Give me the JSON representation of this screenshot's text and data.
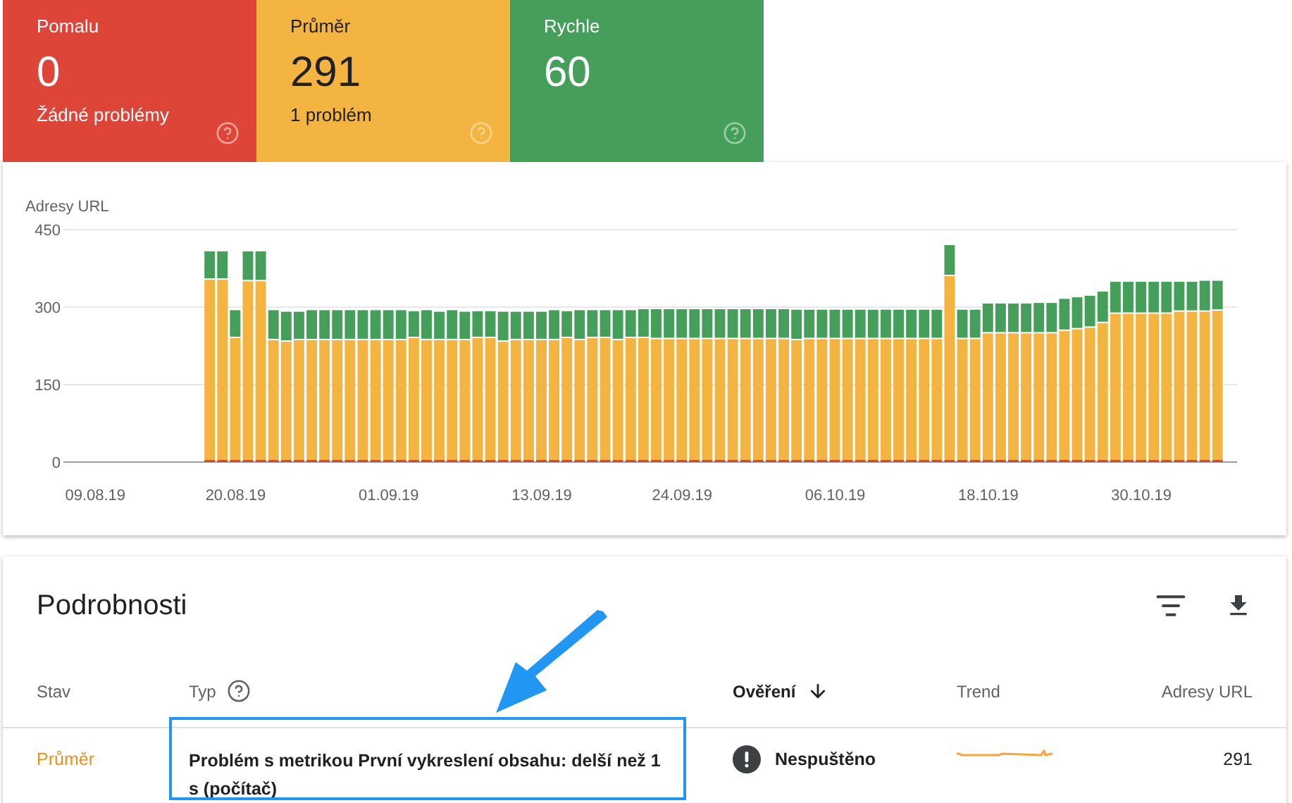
{
  "summary_tiles": [
    {
      "kind": "slow",
      "label": "Pomalu",
      "value": "0",
      "subtitle": "Žádné problémy"
    },
    {
      "kind": "average",
      "label": "Průměr",
      "value": "291",
      "subtitle": "1 problém"
    },
    {
      "kind": "fast",
      "label": "Rychle",
      "value": "60"
    }
  ],
  "chart": {
    "chart_data": {
      "type": "bar",
      "stacked": true,
      "ylabel": "Adresy URL",
      "ylim": [
        0,
        450
      ],
      "yticks": [
        0,
        150,
        300,
        450
      ],
      "categories": [
        null,
        null,
        "09.08.19",
        null,
        null,
        null,
        null,
        null,
        null,
        null,
        null,
        null,
        null,
        "20.08.19",
        null,
        null,
        null,
        null,
        null,
        null,
        null,
        null,
        null,
        null,
        null,
        "01.09.19",
        null,
        null,
        null,
        null,
        null,
        null,
        null,
        null,
        null,
        null,
        null,
        "13.09.19",
        null,
        null,
        null,
        null,
        null,
        null,
        null,
        null,
        null,
        null,
        "24.09.19",
        null,
        null,
        null,
        null,
        null,
        null,
        null,
        null,
        null,
        null,
        null,
        "06.10.19",
        null,
        null,
        null,
        null,
        null,
        null,
        null,
        null,
        null,
        null,
        null,
        "18.10.19",
        null,
        null,
        null,
        null,
        null,
        null,
        null,
        null,
        null,
        null,
        null,
        "30.10.19",
        null,
        null,
        null,
        null,
        null,
        null,
        null
      ],
      "series": [
        {
          "color": "#dd4538",
          "values": [
            null,
            null,
            null,
            null,
            null,
            null,
            null,
            null,
            null,
            null,
            null,
            0,
            0,
            0,
            0,
            0,
            0,
            0,
            0,
            0,
            0,
            0,
            0,
            0,
            0,
            0,
            0,
            0,
            0,
            0,
            0,
            0,
            0,
            0,
            0,
            0,
            0,
            0,
            0,
            0,
            0,
            0,
            0,
            0,
            0,
            0,
            0,
            0,
            0,
            0,
            0,
            0,
            0,
            0,
            0,
            0,
            0,
            0,
            0,
            0,
            0,
            0,
            0,
            0,
            0,
            0,
            0,
            0,
            0,
            0,
            0,
            0,
            0,
            0,
            0,
            0,
            0,
            0,
            0,
            0,
            0,
            0,
            0,
            0,
            0,
            0,
            0,
            0,
            0,
            0,
            0,
            null
          ]
        },
        {
          "color": "#f4b442",
          "values": [
            null,
            null,
            null,
            null,
            null,
            null,
            null,
            null,
            null,
            null,
            null,
            353,
            353,
            240,
            350,
            350,
            236,
            233,
            236,
            236,
            236,
            236,
            236,
            236,
            236,
            236,
            236,
            240,
            236,
            236,
            236,
            236,
            240,
            240,
            233,
            236,
            236,
            236,
            236,
            240,
            236,
            240,
            240,
            236,
            240,
            240,
            238,
            238,
            238,
            238,
            238,
            238,
            238,
            238,
            238,
            238,
            238,
            236,
            238,
            238,
            238,
            238,
            238,
            238,
            238,
            238,
            238,
            238,
            238,
            360,
            238,
            238,
            249,
            249,
            249,
            249,
            249,
            249,
            254,
            257,
            260,
            269,
            287,
            287,
            287,
            287,
            287,
            291,
            291,
            291,
            293,
            null
          ]
        },
        {
          "color": "#459e5a",
          "values": [
            null,
            null,
            null,
            null,
            null,
            null,
            null,
            null,
            null,
            null,
            null,
            55,
            55,
            54,
            58,
            58,
            58,
            58,
            55,
            58,
            58,
            58,
            58,
            58,
            58,
            58,
            58,
            52,
            58,
            55,
            58,
            55,
            52,
            52,
            58,
            55,
            55,
            55,
            58,
            52,
            58,
            54,
            54,
            58,
            54,
            56,
            58,
            58,
            58,
            58,
            58,
            58,
            58,
            58,
            58,
            58,
            58,
            59,
            57,
            57,
            57,
            57,
            57,
            57,
            57,
            57,
            57,
            57,
            57,
            60,
            57,
            57,
            58,
            58,
            58,
            58,
            59,
            59,
            62,
            62,
            62,
            61,
            62,
            62,
            62,
            62,
            62,
            58,
            58,
            60,
            58,
            null
          ]
        }
      ]
    }
  },
  "details": {
    "title": "Podrobnosti",
    "columns": [
      {
        "label": "Stav",
        "sorted": false,
        "help": false
      },
      {
        "label": "Typ",
        "sorted": false,
        "help": true
      },
      {
        "label": "Ověření",
        "sorted": true,
        "help": false
      },
      {
        "label": "Trend",
        "sorted": false,
        "help": false
      },
      {
        "label": "Adresy URL",
        "sorted": false,
        "help": false
      }
    ],
    "rows": [
      {
        "status": "Průměr",
        "kind": "average",
        "type": "Problém s metrikou První vykreslení obsahu: delší než 1 s (počítač)",
        "validation": "Nespuštěno",
        "urls": "291"
      }
    ]
  }
}
